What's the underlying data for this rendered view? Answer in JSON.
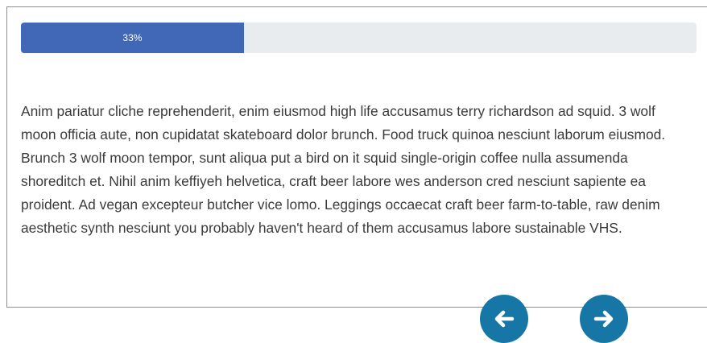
{
  "progress": {
    "percent": 33,
    "label": "33%",
    "fill_color": "#4068b6",
    "track_color": "#e9ecef"
  },
  "content": {
    "paragraph": "Anim pariatur cliche reprehenderit, enim eiusmod high life accusamus terry richardson ad squid. 3 wolf moon officia aute, non cupidatat skateboard dolor brunch. Food truck quinoa nesciunt laborum eiusmod. Brunch 3 wolf moon tempor, sunt aliqua put a bird on it squid single-origin coffee nulla assumenda shoreditch et. Nihil anim keffiyeh helvetica, craft beer labore wes anderson cred nesciunt sapiente ea proident. Ad vegan excepteur butcher vice lomo. Leggings occaecat craft beer farm-to-table, raw denim aesthetic synth nesciunt you probably haven't heard of them accusamus labore sustainable VHS."
  },
  "navigation": {
    "prev_icon": "arrow-left-icon",
    "next_icon": "arrow-right-icon",
    "button_color": "#1677a6"
  }
}
